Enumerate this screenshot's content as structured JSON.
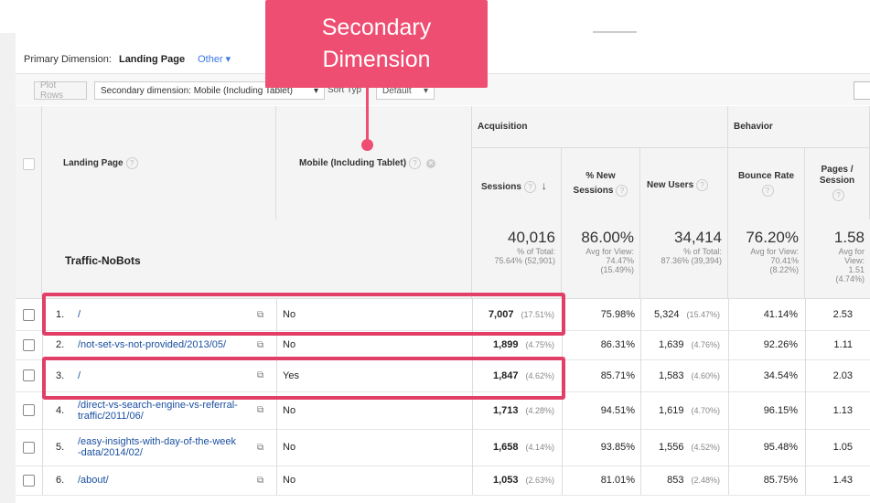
{
  "primary_dimension": {
    "label": "Primary Dimension:",
    "active": "Landing Page",
    "other": "Other"
  },
  "toolbar": {
    "plot_rows": "Plot Rows",
    "secondary_dimension": "Secondary dimension: Mobile (Including Tablet)",
    "sort_type": "Sort Typ",
    "default": "Default"
  },
  "callout": {
    "line1": "Secondary",
    "line2": "Dimension"
  },
  "headers": {
    "landing_page": "Landing Page",
    "mobile": "Mobile (Including Tablet)",
    "acquisition": "Acquisition",
    "behavior": "Behavior",
    "sessions": "Sessions",
    "pct_new_sessions_1": "% New",
    "pct_new_sessions_2": "Sessions",
    "new_users": "New Users",
    "bounce_rate": "Bounce Rate",
    "pages_session_1": "Pages /",
    "pages_session_2": "Session"
  },
  "totals": {
    "segment": "Traffic-NoBots",
    "sessions": {
      "big": "40,016",
      "l1": "% of Total:",
      "l2": "75.64% (52,901)"
    },
    "pct_new": {
      "big": "86.00%",
      "l1": "Avg for View:",
      "l2": "74.47%",
      "l3": "(15.49%)"
    },
    "new_users": {
      "big": "34,414",
      "l1": "% of Total:",
      "l2": "87.36% (39,394)"
    },
    "bounce": {
      "big": "76.20%",
      "l1": "Avg for View:",
      "l2": "70.41%",
      "l3": "(8.22%)"
    },
    "pages": {
      "big": "1.58",
      "l1": "Avg for",
      "l2": "View:",
      "l3": "1.51",
      "l4": "(4.74%)"
    }
  },
  "rows": [
    {
      "idx": "1.",
      "page": "/",
      "mobile": "No",
      "sessions": "7,007",
      "sessions_pct": "(17.51%)",
      "pct_new": "75.98%",
      "new_users": "5,324",
      "new_users_pct": "(15.47%)",
      "bounce": "41.14%",
      "pages": "2.53"
    },
    {
      "idx": "2.",
      "page": "/not-set-vs-not-provided/2013/05/",
      "mobile": "No",
      "sessions": "1,899",
      "sessions_pct": "(4.75%)",
      "pct_new": "86.31%",
      "new_users": "1,639",
      "new_users_pct": "(4.76%)",
      "bounce": "92.26%",
      "pages": "1.11"
    },
    {
      "idx": "3.",
      "page": "/",
      "mobile": "Yes",
      "sessions": "1,847",
      "sessions_pct": "(4.62%)",
      "pct_new": "85.71%",
      "new_users": "1,583",
      "new_users_pct": "(4.60%)",
      "bounce": "34.54%",
      "pages": "2.03"
    },
    {
      "idx": "4.",
      "page_l1": "/direct-vs-search-engine-vs-referral-",
      "page_l2": "traffic/2011/06/",
      "mobile": "No",
      "sessions": "1,713",
      "sessions_pct": "(4.28%)",
      "pct_new": "94.51%",
      "new_users": "1,619",
      "new_users_pct": "(4.70%)",
      "bounce": "96.15%",
      "pages": "1.13"
    },
    {
      "idx": "5.",
      "page_l1": "/easy-insights-with-day-of-the-week",
      "page_l2": "-data/2014/02/",
      "mobile": "No",
      "sessions": "1,658",
      "sessions_pct": "(4.14%)",
      "pct_new": "93.85%",
      "new_users": "1,556",
      "new_users_pct": "(4.52%)",
      "bounce": "95.48%",
      "pages": "1.05"
    },
    {
      "idx": "6.",
      "page": "/about/",
      "mobile": "No",
      "sessions": "1,053",
      "sessions_pct": "(2.63%)",
      "pct_new": "81.01%",
      "new_users": "853",
      "new_users_pct": "(2.48%)",
      "bounce": "85.75%",
      "pages": "1.43"
    }
  ],
  "colors": {
    "accent": "#ee4e72",
    "highlight": "#e23f67",
    "link": "#1a4fa0"
  }
}
